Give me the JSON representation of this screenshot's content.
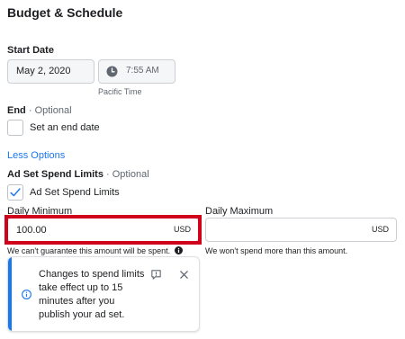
{
  "section": {
    "title": "Budget & Schedule"
  },
  "start_date": {
    "label": "Start Date",
    "date_value": "May 2, 2020",
    "time_value": "7:55 AM",
    "timezone": "Pacific Time"
  },
  "end": {
    "label": "End",
    "optional": "· Optional",
    "checkbox_label": "Set an end date",
    "checked": false
  },
  "less_options": "Less Options",
  "spend_limits": {
    "label": "Ad Set Spend Limits",
    "optional": "· Optional",
    "checkbox_label": "Ad Set Spend Limits",
    "checked": true,
    "daily_minimum": {
      "label": "Daily Minimum",
      "value": "100.00",
      "currency": "USD",
      "note": "We can't guarantee this amount will be spent."
    },
    "daily_maximum": {
      "label": "Daily Maximum",
      "value": "",
      "currency": "USD",
      "note": "We won't spend more than this amount."
    }
  },
  "info_card": {
    "text": "Changes to spend limits take effect up to 15 minutes after you publish your ad set."
  },
  "colors": {
    "accent": "#1877f2",
    "highlight": "#d0021b"
  },
  "icons": [
    "clock-icon",
    "checkmark-icon",
    "info-circle-icon",
    "feedback-icon",
    "close-icon"
  ]
}
